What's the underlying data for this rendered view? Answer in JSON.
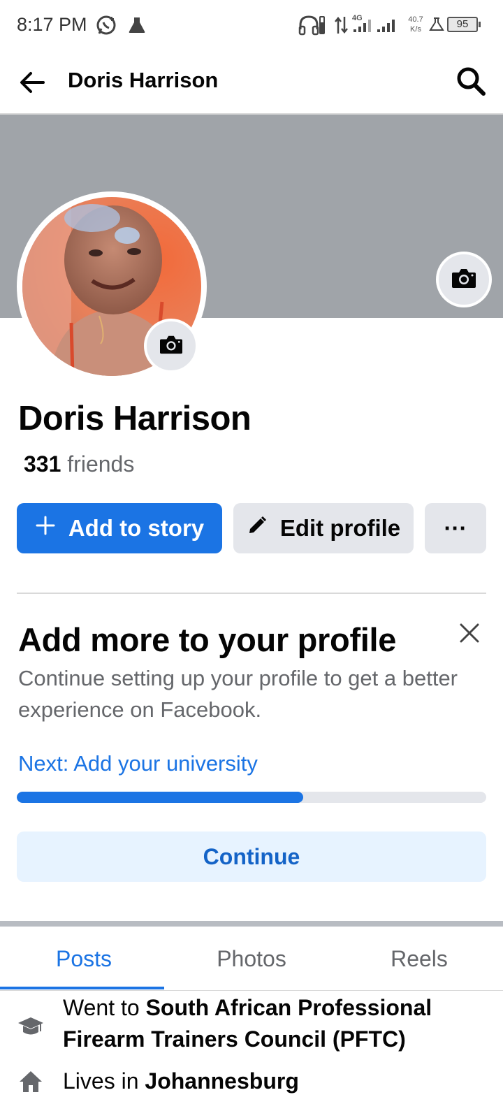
{
  "status_bar": {
    "time": "8:17 PM",
    "network_type": "4G",
    "speed_value": "40.7",
    "speed_unit": "K/s",
    "battery": "95",
    "icons": [
      "whatsapp-icon",
      "flask-icon",
      "headphones-icon",
      "data-transfer-icon",
      "signal-icon",
      "signal-icon",
      "alert-flask-icon",
      "battery-icon"
    ]
  },
  "header": {
    "title": "Doris Harrison",
    "back_icon": "arrow-left-icon",
    "search_icon": "search-icon"
  },
  "profile": {
    "name": "Doris Harrison",
    "friends_count": "331",
    "friends_label": "friends"
  },
  "actions": {
    "add_story": "Add to story",
    "edit_profile": "Edit profile",
    "more": "···"
  },
  "card": {
    "title": "Add more to your profile",
    "description": "Continue setting up your profile to get a better experience on Facebook.",
    "next": "Next: Add your university",
    "progress": 0.61,
    "continue": "Continue"
  },
  "tabs": [
    {
      "label": "Posts",
      "active": true
    },
    {
      "label": "Photos",
      "active": false
    },
    {
      "label": "Reels",
      "active": false
    }
  ],
  "details": [
    {
      "icon": "graduation-cap-icon",
      "prefix": "Went to ",
      "value": "South African Professional Firearm Trainers Council (PFTC)"
    },
    {
      "icon": "home-icon",
      "prefix": "Lives in ",
      "value": "Johannesburg"
    }
  ],
  "colors": {
    "brand_blue": "#1b74e4",
    "cover_gray": "#a0a4a9",
    "button_gray": "#e4e6eb",
    "continue_bg": "#e7f3ff"
  }
}
